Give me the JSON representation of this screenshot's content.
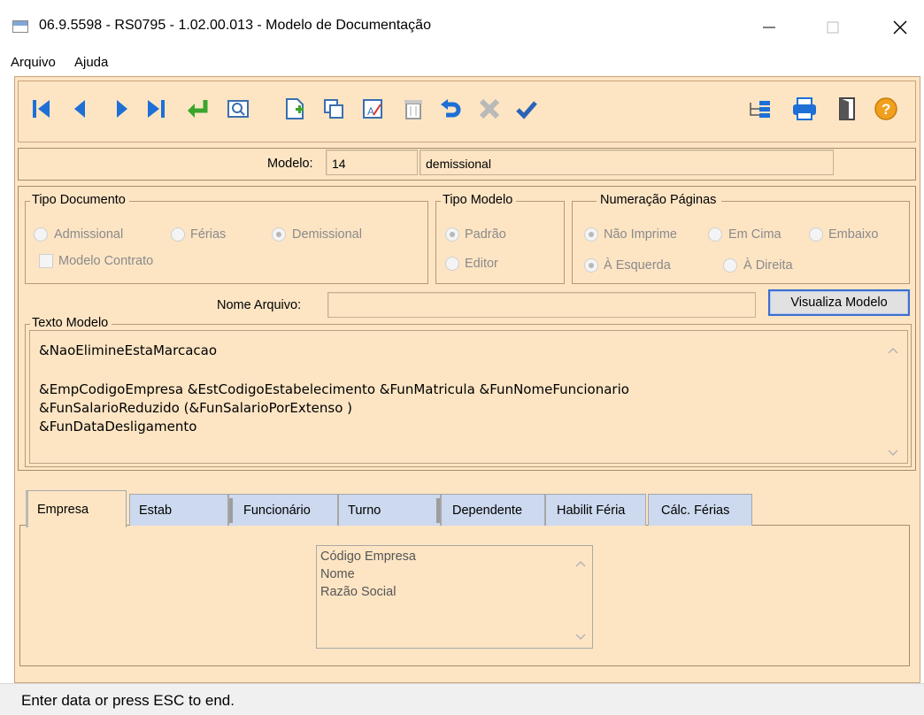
{
  "window": {
    "title": "06.9.5598 - RS0795 - 1.02.00.013 - Modelo de Documentação"
  },
  "menu": {
    "items": [
      "Arquivo",
      "Ajuda"
    ]
  },
  "toolbar": {
    "icons": [
      "first-record-icon",
      "previous-record-icon",
      "next-record-icon",
      "last-record-icon",
      "goto-icon",
      "search-zoom-icon",
      "new-record-icon",
      "copy-record-icon",
      "edit-record-icon",
      "delete-icon",
      "undo-icon",
      "cancel-icon",
      "confirm-icon",
      "tree-list-icon",
      "print-icon",
      "exit-icon",
      "help-icon"
    ]
  },
  "modelo": {
    "label": "Modelo:",
    "code": "14",
    "description": "demissional"
  },
  "tipo_documento": {
    "title": "Tipo Documento",
    "options": [
      "Admissional",
      "Férias",
      "Demissional"
    ],
    "selected": "Demissional",
    "checkbox": "Modelo Contrato"
  },
  "tipo_modelo": {
    "title": "Tipo Modelo",
    "options": [
      "Padrão",
      "Editor"
    ],
    "selected": "Padrão"
  },
  "numeracao": {
    "title": "Numeração Páginas",
    "options_row1": [
      "Não Imprime",
      "Em Cima",
      "Embaixo"
    ],
    "options_row2": [
      "À Esquerda",
      "À Direita"
    ],
    "selected_row1": "Não Imprime",
    "selected_row2": "À Esquerda"
  },
  "arquivo": {
    "label": "Nome Arquivo:",
    "value": ""
  },
  "visualiza_button": "Visualiza Modelo",
  "texto_modelo": {
    "title": "Texto Modelo",
    "lines": [
      "&NaoElimineEstaMarcacao",
      "",
      "&EmpCodigoEmpresa &EstCodigoEstabelecimento &FunMatricula &FunNomeFuncionario",
      "&FunSalarioReduzido (&FunSalarioPorExtenso )",
      "&FunDataDesligamento"
    ]
  },
  "tabs": [
    "Empresa",
    "Estab",
    "Funcionário",
    "Turno",
    "Dependente",
    "Habilit Féria",
    "Cálc. Férias"
  ],
  "active_tab": "Empresa",
  "fields_list": [
    "Código Empresa",
    "Nome",
    "Razão Social"
  ],
  "status": "Enter data or press ESC to end.",
  "colors": {
    "panel": "#fde5c4",
    "tab": "#ccd9ee",
    "accent": "#3c6fcf"
  }
}
